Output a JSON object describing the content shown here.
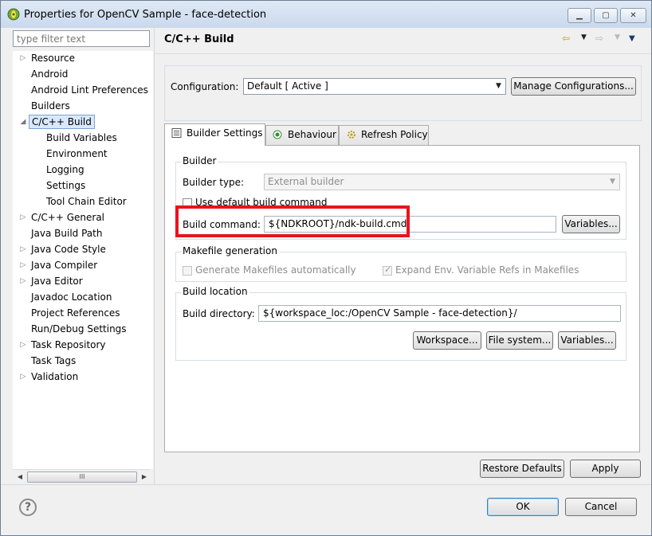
{
  "window": {
    "title": "Properties for OpenCV Sample - face-detection",
    "controls": [
      "minimize-icon",
      "maximize-icon",
      "close-icon"
    ]
  },
  "sidebar": {
    "filter_placeholder": "type filter text",
    "tree": [
      {
        "label": "Resource",
        "level": 0,
        "expandable": true,
        "expanded": false
      },
      {
        "label": "Android",
        "level": 0,
        "expandable": false
      },
      {
        "label": "Android Lint Preferences",
        "level": 0,
        "expandable": false
      },
      {
        "label": "Builders",
        "level": 0,
        "expandable": false
      },
      {
        "label": "C/C++ Build",
        "level": 0,
        "expandable": true,
        "expanded": true,
        "selected": true
      },
      {
        "label": "Build Variables",
        "level": 1,
        "expandable": false
      },
      {
        "label": "Environment",
        "level": 1,
        "expandable": false
      },
      {
        "label": "Logging",
        "level": 1,
        "expandable": false
      },
      {
        "label": "Settings",
        "level": 1,
        "expandable": false
      },
      {
        "label": "Tool Chain Editor",
        "level": 1,
        "expandable": false
      },
      {
        "label": "C/C++ General",
        "level": 0,
        "expandable": true,
        "expanded": false
      },
      {
        "label": "Java Build Path",
        "level": 0,
        "expandable": false
      },
      {
        "label": "Java Code Style",
        "level": 0,
        "expandable": true,
        "expanded": false
      },
      {
        "label": "Java Compiler",
        "level": 0,
        "expandable": true,
        "expanded": false
      },
      {
        "label": "Java Editor",
        "level": 0,
        "expandable": true,
        "expanded": false
      },
      {
        "label": "Javadoc Location",
        "level": 0,
        "expandable": false
      },
      {
        "label": "Project References",
        "level": 0,
        "expandable": false
      },
      {
        "label": "Run/Debug Settings",
        "level": 0,
        "expandable": false
      },
      {
        "label": "Task Repository",
        "level": 0,
        "expandable": true,
        "expanded": false
      },
      {
        "label": "Task Tags",
        "level": 0,
        "expandable": false
      },
      {
        "label": "Validation",
        "level": 0,
        "expandable": true,
        "expanded": false
      }
    ],
    "scrollbar_grip": "III"
  },
  "page": {
    "title": "C/C++ Build",
    "configuration": {
      "label": "Configuration:",
      "value": "Default  [ Active ]",
      "manage_button": "Manage Configurations..."
    },
    "tabs": [
      {
        "label": "Builder Settings",
        "icon": "list-icon",
        "active": true
      },
      {
        "label": "Behaviour",
        "icon": "radio-icon",
        "active": false
      },
      {
        "label": "Refresh Policy",
        "icon": "refresh-gear-icon",
        "active": false
      }
    ],
    "builder": {
      "group_title": "Builder",
      "type_label": "Builder type:",
      "type_value": "External builder",
      "use_default_label": "Use default build command",
      "use_default_checked": false,
      "command_label": "Build command:",
      "command_value": "${NDKROOT}/ndk-build.cmd",
      "variables_button": "Variables..."
    },
    "makefile": {
      "group_title": "Makefile generation",
      "generate_label": "Generate Makefiles automatically",
      "generate_checked": false,
      "expand_label": "Expand Env. Variable Refs in Makefiles",
      "expand_checked": true
    },
    "location": {
      "group_title": "Build location",
      "dir_label": "Build directory:",
      "dir_value": "${workspace_loc:/OpenCV Sample - face-detection}/",
      "workspace_button": "Workspace...",
      "filesystem_button": "File system...",
      "variables_button": "Variables..."
    },
    "restore_defaults_button": "Restore Defaults",
    "apply_button": "Apply"
  },
  "footer": {
    "help_icon": "help-icon",
    "help_glyph": "?",
    "ok_button": "OK",
    "cancel_button": "Cancel"
  },
  "colors": {
    "highlight_box": "#e8141e",
    "selection_bg": "#d9e8fb",
    "window_bg": "#f0f0f0"
  }
}
